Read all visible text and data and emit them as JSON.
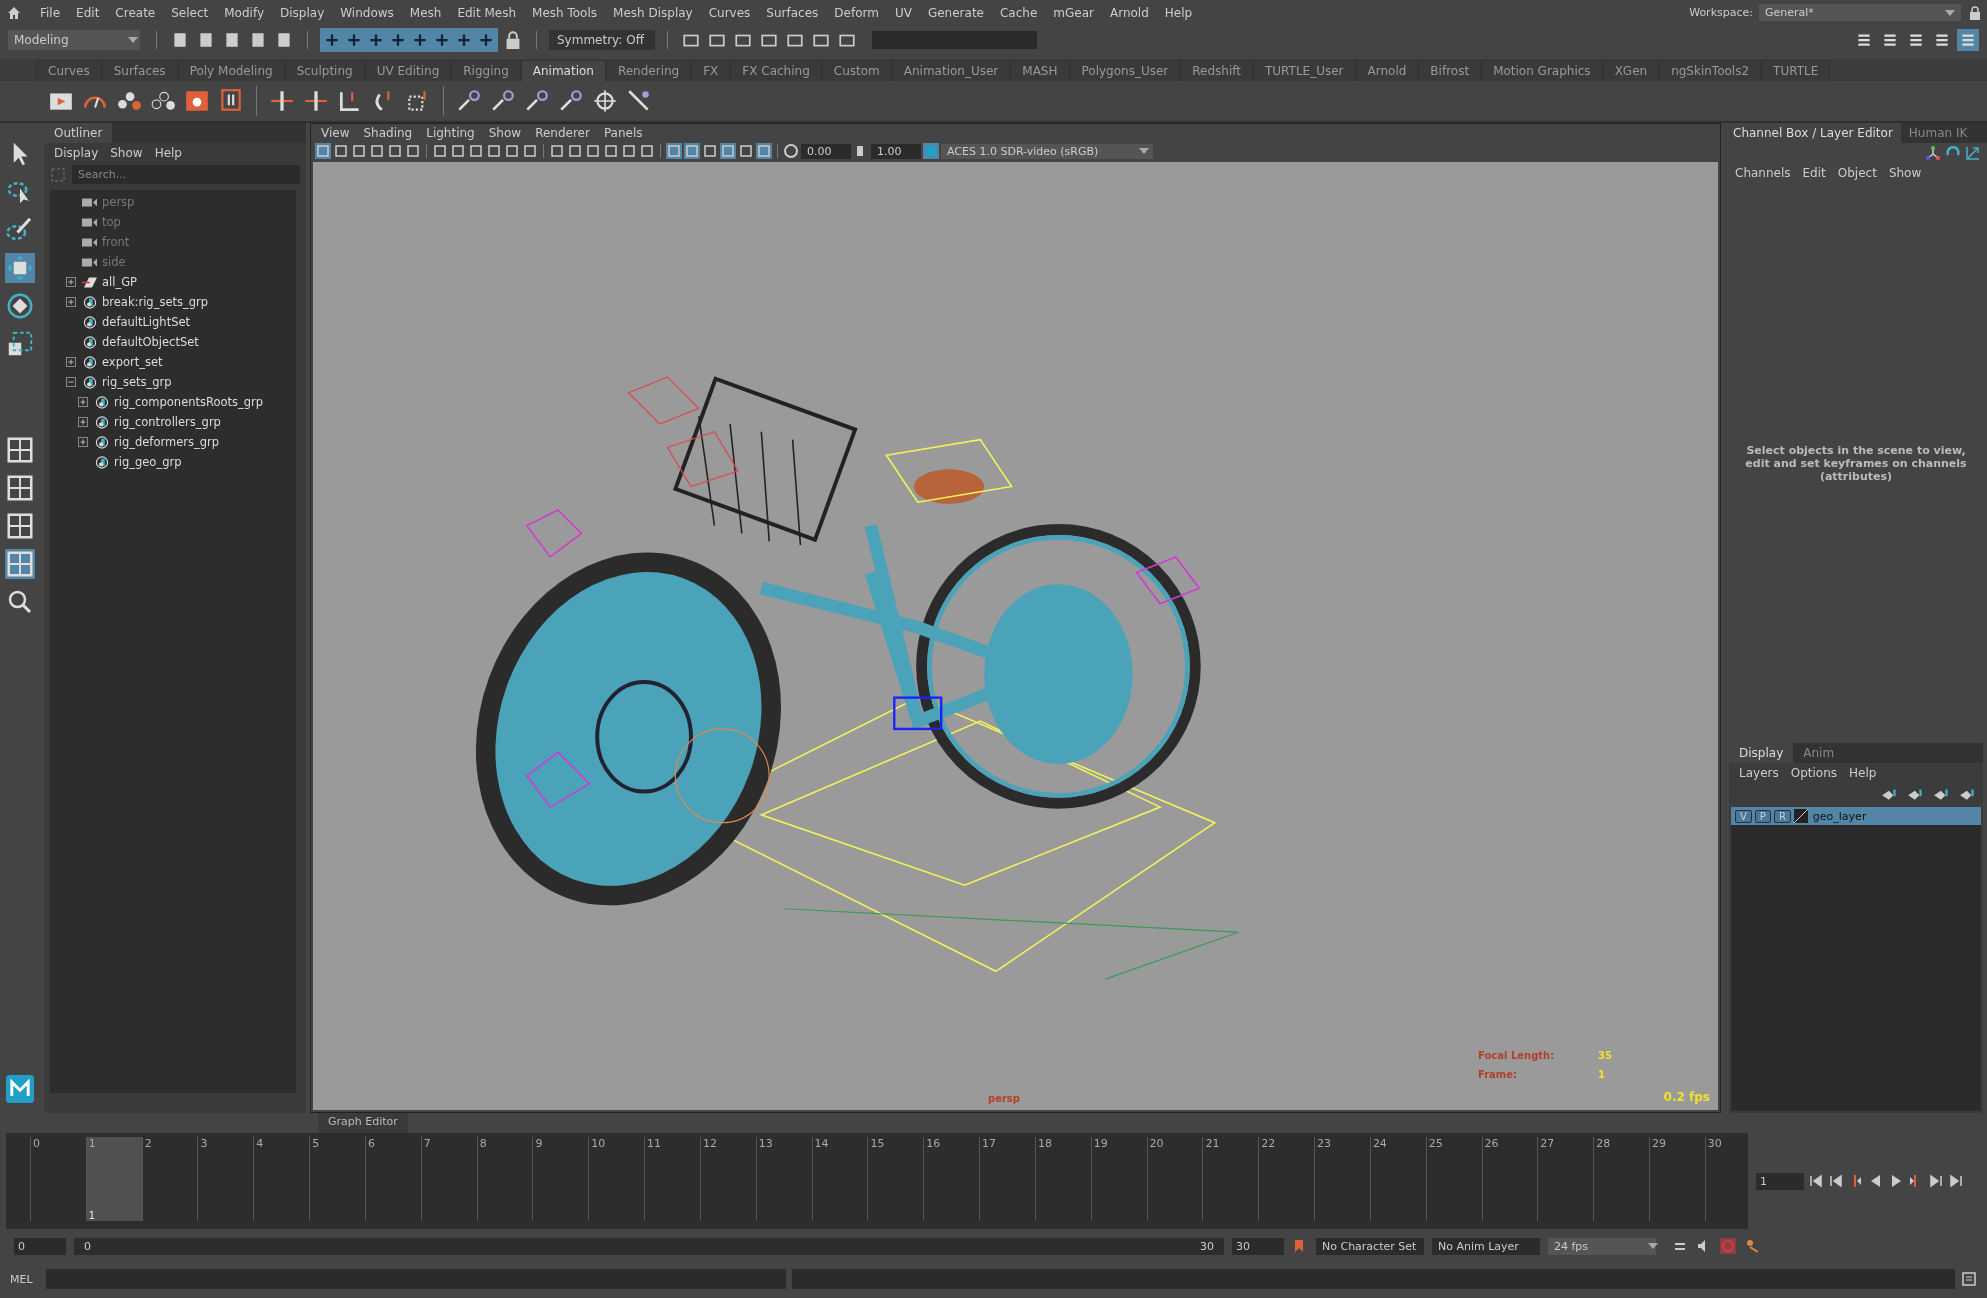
{
  "menu_bar": [
    "File",
    "Edit",
    "Create",
    "Select",
    "Modify",
    "Display",
    "Windows",
    "Mesh",
    "Edit Mesh",
    "Mesh Tools",
    "Mesh Display",
    "Curves",
    "Surfaces",
    "Deform",
    "UV",
    "Generate",
    "Cache",
    "mGear",
    "Arnold",
    "Help"
  ],
  "workspace": {
    "label": "Workspace:",
    "value": "General*"
  },
  "status_line": {
    "mode": "Modeling",
    "symmetry": "Symmetry: Off"
  },
  "shelf_tabs": [
    {
      "label": "Curves",
      "selected": false
    },
    {
      "label": "Surfaces",
      "selected": false
    },
    {
      "label": "Poly Modeling",
      "selected": false
    },
    {
      "label": "Sculpting",
      "selected": false
    },
    {
      "label": "UV Editing",
      "selected": false
    },
    {
      "label": "Rigging",
      "selected": false
    },
    {
      "label": "Animation",
      "selected": true
    },
    {
      "label": "Rendering",
      "selected": false
    },
    {
      "label": "FX",
      "selected": false
    },
    {
      "label": "FX Caching",
      "selected": false
    },
    {
      "label": "Custom",
      "selected": false
    },
    {
      "label": "Animation_User",
      "selected": false
    },
    {
      "label": "MASH",
      "selected": false
    },
    {
      "label": "Polygons_User",
      "selected": false
    },
    {
      "label": "Redshift",
      "selected": false
    },
    {
      "label": "TURTLE_User",
      "selected": false
    },
    {
      "label": "Arnold",
      "selected": false
    },
    {
      "label": "Bifrost",
      "selected": false
    },
    {
      "label": "Motion Graphics",
      "selected": false
    },
    {
      "label": "XGen",
      "selected": false
    },
    {
      "label": "ngSkinTools2",
      "selected": false
    },
    {
      "label": "TURTLE",
      "selected": false
    }
  ],
  "outliner": {
    "tab": "Outliner",
    "menu": [
      "Display",
      "Show",
      "Help"
    ],
    "search": {
      "placeholder": "Search..."
    },
    "items": [
      {
        "label": "persp",
        "kind": "camera",
        "greyed": true
      },
      {
        "label": "top",
        "kind": "camera",
        "greyed": true
      },
      {
        "label": "front",
        "kind": "camera",
        "greyed": true
      },
      {
        "label": "side",
        "kind": "camera",
        "greyed": true
      },
      {
        "label": "all_GP",
        "kind": "layer",
        "greyed": false,
        "expanded": false
      },
      {
        "label": "break:rig_sets_grp",
        "kind": "set",
        "greyed": false,
        "expanded": false
      },
      {
        "label": "defaultLightSet",
        "kind": "set",
        "greyed": false
      },
      {
        "label": "defaultObjectSet",
        "kind": "set",
        "greyed": false
      },
      {
        "label": "export_set",
        "kind": "set",
        "greyed": false,
        "expanded": false
      },
      {
        "label": "rig_sets_grp",
        "kind": "set",
        "greyed": false,
        "expanded": true,
        "children": [
          {
            "label": "rig_componentsRoots_grp",
            "kind": "set",
            "greyed": false,
            "expanded": false
          },
          {
            "label": "rig_controllers_grp",
            "kind": "set",
            "greyed": false,
            "expanded": false
          },
          {
            "label": "rig_deformers_grp",
            "kind": "set",
            "greyed": false,
            "expanded": false
          },
          {
            "label": "rig_geo_grp",
            "kind": "set",
            "greyed": false
          }
        ]
      }
    ]
  },
  "viewport": {
    "menu": [
      "View",
      "Shading",
      "Lighting",
      "Show",
      "Renderer",
      "Panels"
    ],
    "exposure": "0.00",
    "gamma": "1.00",
    "color_space": "ACES 1.0 SDR-video (sRGB)",
    "hud": {
      "focal_label": "Focal Length:",
      "focal_value": "35",
      "frame_label": "Frame:",
      "frame_value": "1",
      "camera": "persp",
      "fps": "0.2 fps"
    }
  },
  "channel_box": {
    "tabs": [
      {
        "label": "Channel Box / Layer Editor",
        "selected": true
      },
      {
        "label": "Human IK",
        "selected": false
      }
    ],
    "menu": [
      "Channels",
      "Edit",
      "Object",
      "Show"
    ],
    "message": "Select objects in the scene to view, edit and set keyframes on channels (attributes)"
  },
  "layer_editor": {
    "tabs": [
      {
        "label": "Display",
        "selected": true
      },
      {
        "label": "Anim",
        "selected": false
      }
    ],
    "menu": [
      "Layers",
      "Options",
      "Help"
    ],
    "layers": [
      {
        "toggles": [
          "V",
          "P",
          "R"
        ],
        "name": "geo_layer",
        "selected": true
      }
    ]
  },
  "graph_editor_tab": "Graph Editor",
  "time_slider": {
    "current_frame": "1",
    "frame_field": "1",
    "frames": [
      {
        "label": "0",
        "selected": false
      },
      {
        "label": "1",
        "selected": true
      },
      {
        "label": "2",
        "selected": false
      },
      {
        "label": "3",
        "selected": false
      },
      {
        "label": "4",
        "selected": false
      },
      {
        "label": "5",
        "selected": false
      },
      {
        "label": "6",
        "selected": false
      },
      {
        "label": "7",
        "selected": false
      },
      {
        "label": "8",
        "selected": false
      },
      {
        "label": "9",
        "selected": false
      },
      {
        "label": "10",
        "selected": false
      },
      {
        "label": "11",
        "selected": false
      },
      {
        "label": "12",
        "selected": false
      },
      {
        "label": "13",
        "selected": false
      },
      {
        "label": "14",
        "selected": false
      },
      {
        "label": "15",
        "selected": false
      },
      {
        "label": "16",
        "selected": false
      },
      {
        "label": "17",
        "selected": false
      },
      {
        "label": "18",
        "selected": false
      },
      {
        "label": "19",
        "selected": false
      },
      {
        "label": "20",
        "selected": false
      },
      {
        "label": "21",
        "selected": false
      },
      {
        "label": "22",
        "selected": false
      },
      {
        "label": "23",
        "selected": false
      },
      {
        "label": "24",
        "selected": false
      },
      {
        "label": "25",
        "selected": false
      },
      {
        "label": "26",
        "selected": false
      },
      {
        "label": "27",
        "selected": false
      },
      {
        "label": "28",
        "selected": false
      },
      {
        "label": "29",
        "selected": false
      },
      {
        "label": "30",
        "selected": false
      }
    ]
  },
  "range_slider": {
    "start": "0",
    "range_start": "0",
    "range_end": "30",
    "end": "30",
    "character_set": "No Character Set",
    "anim_layer": "No Anim Layer",
    "fps": "24 fps"
  },
  "command_line": {
    "label": "MEL"
  }
}
